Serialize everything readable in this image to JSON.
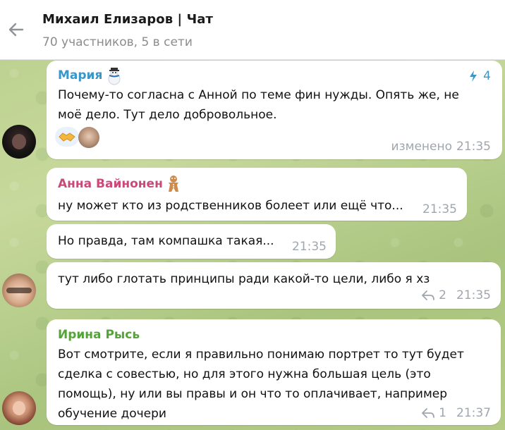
{
  "header": {
    "title": "Михаил Елизаров | Чат",
    "subtitle": "70 участников, 5 в сети"
  },
  "messages": [
    {
      "author": "Мария",
      "author_color": "#3a97c9",
      "badge_count": "4",
      "text": "Почему-то согласна с Анной по теме фин нужды. Опять же, не моё дело. Тут дело добровольное.",
      "edited_label": "изменено",
      "time": "21:35",
      "reactions": [
        "handshake-icon",
        "avatar-reaction"
      ]
    },
    {
      "author": "Анна Вайнонен",
      "author_color": "#c94a79",
      "text": "ну может кто из родственников болеет или ещё что...",
      "time": "21:35"
    },
    {
      "text": "Но правда, там компашка такая...",
      "time": "21:35"
    },
    {
      "text": "тут либо глотать принципы ради какой-то цели, либо я хз",
      "reply_count": "2",
      "time": "21:35"
    },
    {
      "author": "Ирина Рысь",
      "author_color": "#55a43a",
      "text_lines": [
        "Вот смотрите, если я правильно понимаю портрет  то тут будет",
        "сделка с совестью, но для этого нужна большая цель (это",
        "помощь), ну или вы правы и он что то оплачивает, например",
        "обучение дочери"
      ],
      "reply_count": "1",
      "time": "21:37"
    }
  ]
}
